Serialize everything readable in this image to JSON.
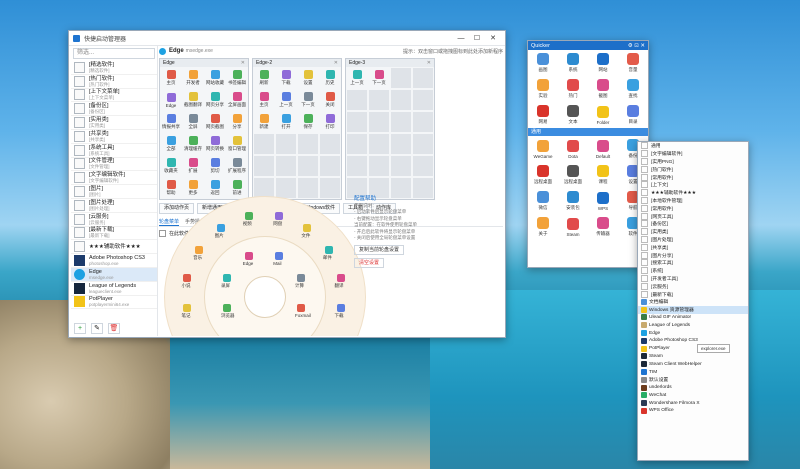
{
  "main": {
    "title": "快捷启动管理器",
    "search_placeholder": "筛选...",
    "programs": [
      {
        "name": "[精选软件]",
        "sub": "[精选软件]"
      },
      {
        "name": "[热门软件]",
        "sub": "[热门软件]"
      },
      {
        "name": "[上下文菜单]",
        "sub": "[上下文菜单]"
      },
      {
        "name": "[备份区]",
        "sub": "[备份区]"
      },
      {
        "name": "[实用类]",
        "sub": "[实用类]"
      },
      {
        "name": "[共享类]",
        "sub": "[共享类]"
      },
      {
        "name": "[系统工具]",
        "sub": "[系统工具]"
      },
      {
        "name": "[文件管理]",
        "sub": "[文件管理]"
      },
      {
        "name": "[文字编辑软件]",
        "sub": "[文字编辑软件]"
      },
      {
        "name": "[图片]",
        "sub": "[图片]"
      },
      {
        "name": "[图片处理]",
        "sub": "[图片处理]"
      },
      {
        "name": "[云服务]",
        "sub": "[云服务]"
      },
      {
        "name": "[最新下载]",
        "sub": "[最新下载]"
      },
      {
        "name": "★★★辅助软件★★★",
        "sub": ""
      },
      {
        "name": "Adobe Photoshop CS3",
        "sub": "photoshop.exe"
      },
      {
        "name": "Edge",
        "sub": "msedge.exe"
      },
      {
        "name": "League of Legends",
        "sub": "leagueclient.exe"
      },
      {
        "name": "PotPlayer",
        "sub": "potplayermini64.exe"
      }
    ],
    "header": {
      "title": "Edge",
      "sub": "msedge.exe",
      "right": "提示：双击窗口或拖拽图标到此处添加新程序"
    },
    "panels": [
      {
        "title": "Edge",
        "cells": [
          "主页",
          "开发者",
          "网站收藏",
          "书签编辑",
          "Edge",
          "截图翻译",
          "网页分享",
          "全屏画面",
          "情报共享",
          "全屏",
          "网页截图",
          "分享",
          "全部",
          "清理缓存",
          "网页转换",
          "窗口管理",
          "收藏夹",
          "扩展",
          "剪切",
          "扩展程序",
          "帮助",
          "更多",
          "返回",
          "前进"
        ]
      },
      {
        "title": "Edge-2",
        "cells": [
          "刷新",
          "下载",
          "设置",
          "历史",
          "主页",
          "上一页",
          "下一页",
          "关闭",
          "新建",
          "打开",
          "保存",
          "打印"
        ]
      },
      {
        "title": "Edge-3",
        "cells": [
          "上一页",
          "下一页"
        ]
      }
    ],
    "toolbar": [
      "添加动作页",
      "新增通用动作页(B)",
      "自动回退上一页",
      "Windows软件",
      "工具箱",
      "动作库"
    ],
    "tabs": [
      "轮盘菜单",
      "手势操作",
      "左键辅助"
    ],
    "wheel_checkbox": "在此软件下使用轮盘菜单",
    "wheel_labels": [
      "小说",
      "音乐",
      "图片",
      "视频",
      "网盘",
      "文件",
      "邮件",
      "翻译",
      "下载",
      "工具",
      "设置",
      "搜索",
      "新闻",
      "地图",
      "截图",
      "笔记",
      "录屏",
      "Edge",
      "Mail",
      "计算",
      "Foxmail",
      "记事本",
      "微信",
      "浏览器"
    ],
    "help": {
      "title": "配置帮助",
      "lines": [
        "使用说明：",
        "- 启动软件后显示轮盘菜单",
        "- 右键拖动显示轮盘菜单",
        "当前配置：在软件使用轮盘菜单",
        "- 开启后此软件将显示轮盘菜单",
        "- 关闭后使用全局轮盘菜单设置"
      ],
      "btn1": "复制当前轮盘设置",
      "btn2": "清空设置"
    },
    "bottom_buttons": [
      "+",
      "✎",
      "🗑"
    ]
  },
  "quicker": {
    "title": "Quicker",
    "grid1": [
      "画图",
      "系统",
      "网站",
      "音量",
      "实验",
      "热门",
      "截图",
      "查找",
      "网易",
      "文本",
      "Folder",
      "目录"
    ],
    "section": "通用",
    "grid2": [
      "WeGame",
      "Dota",
      "Default",
      "备份",
      "远程桌面",
      "远程桌面",
      "课程",
      "设置",
      "微信",
      "安装包",
      "WPS",
      "导航",
      "关于",
      "Steam",
      "传输器",
      "软件"
    ]
  },
  "menu": {
    "items": [
      {
        "t": "通用",
        "type": "box"
      },
      {
        "t": "[文字编辑软件]",
        "type": "box"
      },
      {
        "t": "[实用PNG]",
        "type": "box"
      },
      {
        "t": "[热门软件]",
        "type": "box"
      },
      {
        "t": "[常用软件]",
        "type": "box"
      },
      {
        "t": "[上下文]",
        "type": "box"
      },
      {
        "t": "★★★辅助软件★★★",
        "type": "box"
      },
      {
        "t": "[本地软件管理]",
        "type": "box"
      },
      {
        "t": "[常用软件]",
        "type": "box"
      },
      {
        "t": "[网页工具]",
        "type": "box"
      },
      {
        "t": "[备份区]",
        "type": "box"
      },
      {
        "t": "[实用类]",
        "type": "box"
      },
      {
        "t": "[图片处理]",
        "type": "box"
      },
      {
        "t": "[共享类]",
        "type": "box"
      },
      {
        "t": "[图片分享]",
        "type": "box"
      },
      {
        "t": "[搜索工具]",
        "type": "box"
      },
      {
        "t": "[系统]",
        "type": "box"
      },
      {
        "t": "[开发者工具]",
        "type": "box"
      },
      {
        "t": "[云服务]",
        "type": "box"
      },
      {
        "t": "[最新下载]",
        "type": "box"
      },
      {
        "t": "文档编辑",
        "type": "icon",
        "c": "#4a90d9"
      },
      {
        "t": "Windows 资源管理器",
        "type": "icon",
        "c": "#f2c318"
      },
      {
        "t": "Ulead GIF Animator",
        "type": "icon",
        "c": "#3a7d44"
      },
      {
        "t": "League of Legends",
        "type": "icon",
        "c": "#c8aa6e"
      },
      {
        "t": "Edge",
        "type": "icon",
        "c": "#1da1e2"
      },
      {
        "t": "Adobe Photoshop CS3",
        "type": "icon",
        "c": "#1b3a6b"
      },
      {
        "t": "PotPlayer",
        "type": "icon",
        "c": "#f2c318"
      },
      {
        "t": "Steam",
        "type": "icon",
        "c": "#1b2838"
      },
      {
        "t": "Steam Client WebHelper",
        "type": "icon",
        "c": "#1b2838"
      },
      {
        "t": "TIM",
        "type": "icon",
        "c": "#1e74d0"
      },
      {
        "t": "默认设置",
        "type": "icon",
        "c": "#888888"
      },
      {
        "t": "underlords",
        "type": "icon",
        "c": "#6b3b1b"
      },
      {
        "t": "WeChat",
        "type": "icon",
        "c": "#2aae67"
      },
      {
        "t": "Wondershare Filmora X",
        "type": "icon",
        "c": "#2b3a55"
      },
      {
        "t": "WPS Office",
        "type": "icon",
        "c": "#d9342b"
      }
    ],
    "selected_index": 21,
    "tooltip": "explorer.exe"
  },
  "colors": {
    "accent": "#1e74d0",
    "titlebar_q": "#1d6fc9"
  }
}
